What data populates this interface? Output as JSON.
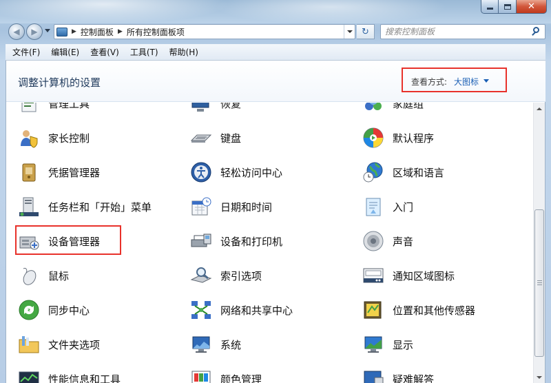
{
  "window": {
    "close_glyph": "✕"
  },
  "nav": {
    "back_glyph": "◀",
    "forward_glyph": "▶",
    "refresh_glyph": "↻",
    "breadcrumb": [
      "控制面板",
      "所有控制面板项"
    ],
    "crumb_separator": "▶",
    "search_placeholder": "搜索控制面板"
  },
  "menubar": {
    "items": [
      "文件(F)",
      "编辑(E)",
      "查看(V)",
      "工具(T)",
      "帮助(H)"
    ]
  },
  "header": {
    "title": "调整计算机的设置",
    "view_by_label": "查看方式:",
    "view_by_value": "大图标"
  },
  "items": {
    "col1": [
      "管理工具",
      "家长控制",
      "凭据管理器",
      "任务栏和「开始」菜单",
      "设备管理器",
      "鼠标",
      "同步中心",
      "文件夹选项",
      "性能信息和工具"
    ],
    "col2": [
      "恢复",
      "键盘",
      "轻松访问中心",
      "日期和时间",
      "设备和打印机",
      "索引选项",
      "网络和共享中心",
      "系统",
      "颜色管理"
    ],
    "col3": [
      "家庭组",
      "默认程序",
      "区域和语言",
      "入门",
      "声音",
      "通知区域图标",
      "位置和其他传感器",
      "显示",
      "疑难解答"
    ]
  },
  "colors": {
    "accent": "#1a5fb4",
    "highlight_box": "#e8312a",
    "title": "#1e395b"
  }
}
